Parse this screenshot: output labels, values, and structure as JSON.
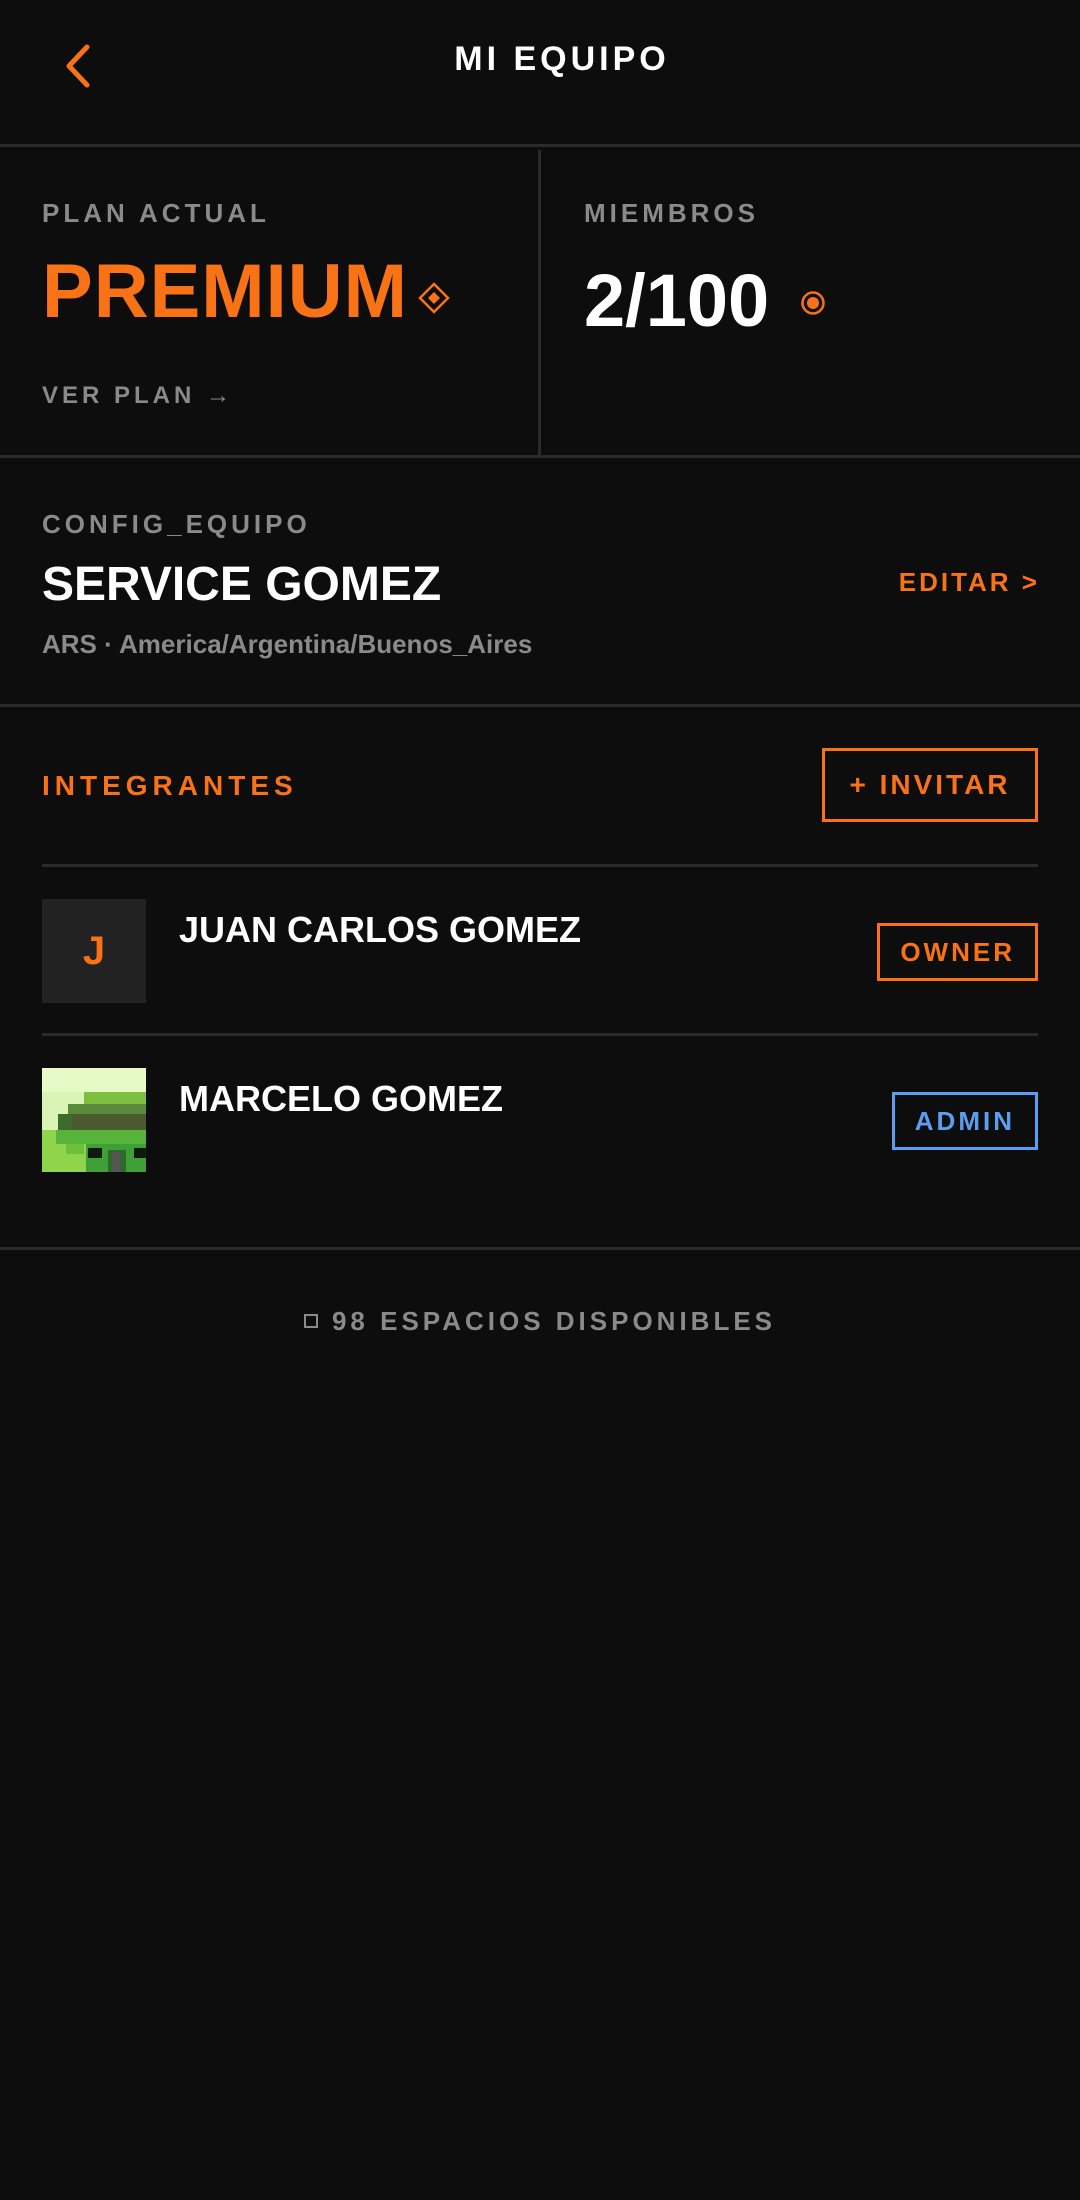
{
  "header": {
    "title": "MI EQUIPO"
  },
  "plan": {
    "label": "PLAN ACTUAL",
    "value": "PREMIUM",
    "link_label": "VER PLAN →"
  },
  "members_stat": {
    "label": "MIEMBROS",
    "value": "2/100"
  },
  "config": {
    "label": "CONFIG_EQUIPO",
    "team_name": "SERVICE GOMEZ",
    "edit_label": "EDITAR >",
    "meta": "ARS · America/Argentina/Buenos_Aires"
  },
  "members": {
    "title": "INTEGRANTES",
    "invite_label": "+ INVITAR",
    "list": [
      {
        "initial": "J",
        "name": "JUAN CARLOS GOMEZ",
        "role": "OWNER"
      },
      {
        "initial": "",
        "name": "MARCELO GOMEZ",
        "role": "ADMIN"
      }
    ]
  },
  "footer": {
    "available": "98 ESPACIOS DISPONIBLES"
  },
  "colors": {
    "accent": "#f97316",
    "admin": "#5b9ef0",
    "background": "#0d0d0d",
    "muted": "#8a8a8a"
  },
  "icons": {
    "back": "chevron-left-icon",
    "plan": "diamond-icon",
    "members": "target-icon",
    "footer": "square-icon"
  }
}
